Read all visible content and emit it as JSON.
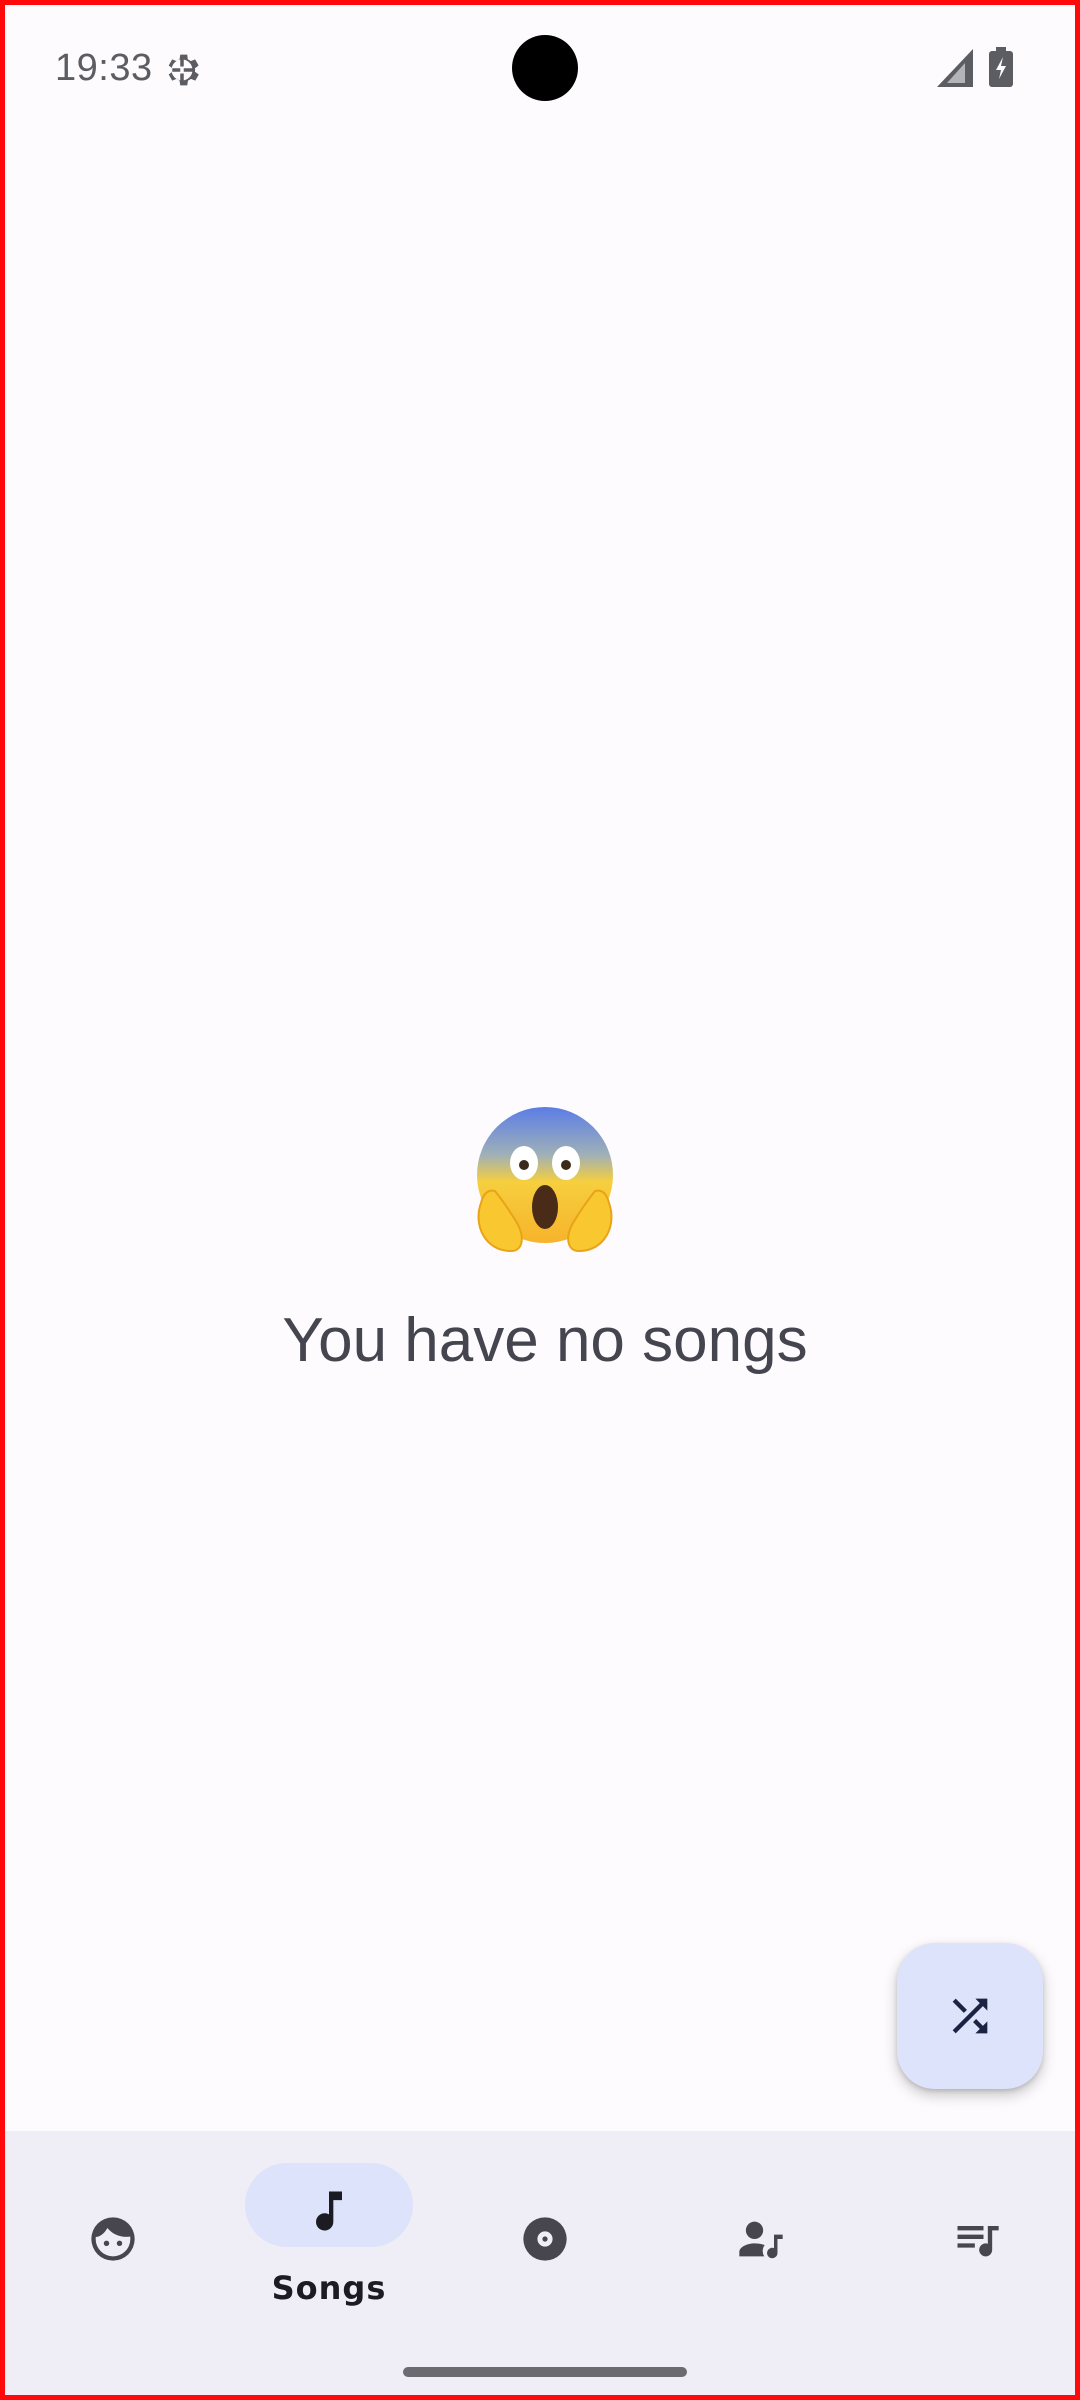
{
  "status_bar": {
    "time": "19:33",
    "icons": [
      "settings-gear-icon",
      "cellular-signal-icon",
      "battery-charging-icon"
    ]
  },
  "empty_state": {
    "emoji": "face-screaming-in-fear",
    "message": "You have no songs"
  },
  "fab": {
    "icon": "shuffle-icon"
  },
  "bottom_nav": {
    "items": [
      {
        "id": "for-you",
        "icon": "face-icon",
        "label": "",
        "selected": false
      },
      {
        "id": "songs",
        "icon": "music-note-icon",
        "label": "Songs",
        "selected": true
      },
      {
        "id": "albums",
        "icon": "album-icon",
        "label": "",
        "selected": false
      },
      {
        "id": "artists",
        "icon": "artist-icon",
        "label": "",
        "selected": false
      },
      {
        "id": "playlists",
        "icon": "playlist-icon",
        "label": "",
        "selected": false
      }
    ]
  },
  "colors": {
    "background": "#fdfbfd",
    "nav_background": "#efedf5",
    "accent_container": "#dde3fa",
    "on_surface": "#45454f",
    "icon": "#47464f",
    "frame_border": "#ff0a0a"
  }
}
